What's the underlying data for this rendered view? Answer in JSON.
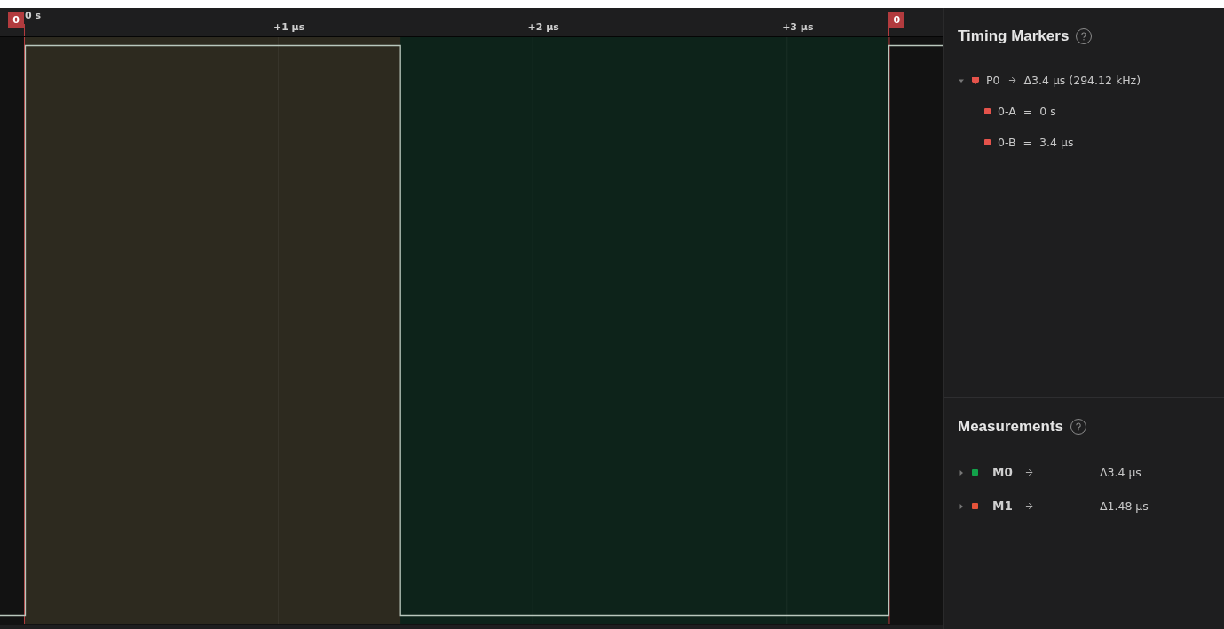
{
  "ruler": {
    "ticks": [
      "0 s",
      "+1 μs",
      "+2 μs",
      "+3 μs"
    ],
    "flags": [
      {
        "label": "0",
        "color": "#b23b3e"
      },
      {
        "label": "0",
        "color": "#b23b3e"
      }
    ]
  },
  "timing_markers": {
    "title": "Timing Markers",
    "pairs": [
      {
        "name": "P0",
        "delta": "Δ3.4 μs (294.12 kHz)",
        "expanded": true,
        "color": "#e5534b",
        "children": [
          {
            "name": "0-A",
            "operator": "=",
            "value": "0 s",
            "color": "#e5534b"
          },
          {
            "name": "0-B",
            "operator": "=",
            "value": "3.4 μs",
            "color": "#e5534b"
          }
        ]
      }
    ]
  },
  "measurements": {
    "title": "Measurements",
    "items": [
      {
        "name": "M0",
        "value": "Δ3.4 μs",
        "color": "#12a24a",
        "expanded": false
      },
      {
        "name": "M1",
        "value": "Δ1.48 μs",
        "color": "#e5533a",
        "expanded": false
      }
    ]
  }
}
